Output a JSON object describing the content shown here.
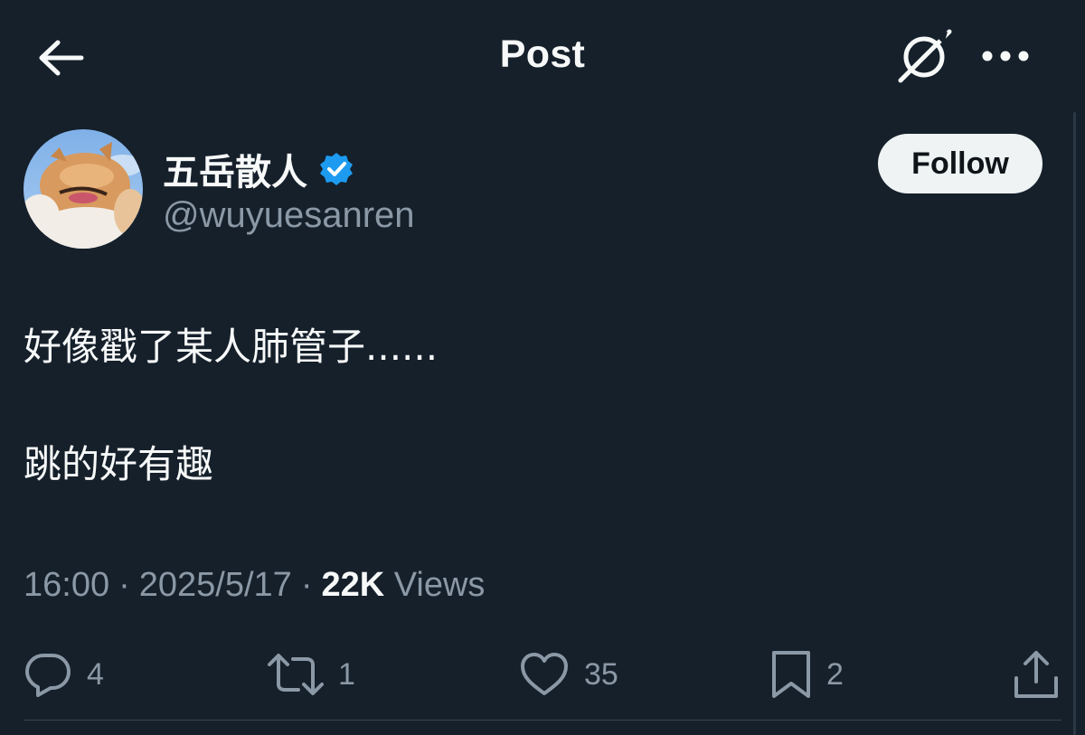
{
  "header": {
    "title": "Post",
    "back_icon": "arrow-left-icon",
    "grok_icon": "grok-icon",
    "more_icon": "more-horizontal-icon"
  },
  "author": {
    "name": "五岳散人",
    "handle": "@wuyuesanren",
    "verified": true,
    "verified_color": "#1d9bf0",
    "avatar_icon": "avatar-cat-photo"
  },
  "follow_button": {
    "label": "Follow"
  },
  "post": {
    "lines": [
      "好像戳了某人肺管子......",
      "跳的好有趣"
    ]
  },
  "meta": {
    "time": "16:00",
    "separator": "·",
    "date": "2025/5/17",
    "views_count": "22K",
    "views_label": "Views"
  },
  "actions": {
    "reply": {
      "icon": "reply-icon",
      "count": "4"
    },
    "repost": {
      "icon": "repost-icon",
      "count": "1"
    },
    "like": {
      "icon": "heart-icon",
      "count": "35"
    },
    "bookmark": {
      "icon": "bookmark-icon",
      "count": "2"
    },
    "share": {
      "icon": "share-icon"
    }
  },
  "colors": {
    "background": "#15202b",
    "text_primary": "#f7f9f9",
    "text_secondary": "#8b98a5",
    "accent": "#1d9bf0"
  }
}
